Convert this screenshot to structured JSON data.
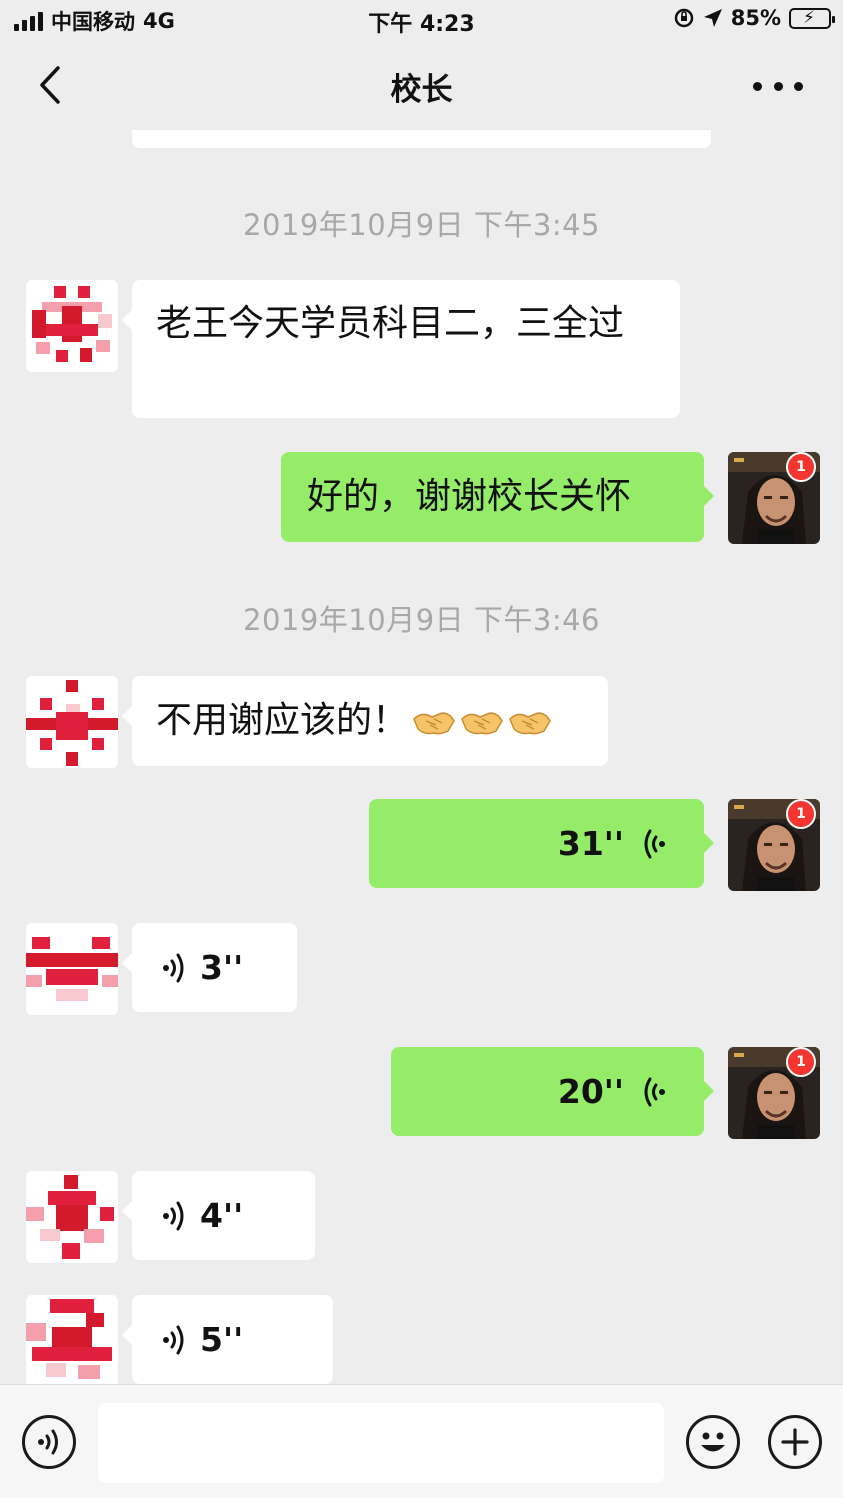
{
  "status_bar": {
    "carrier": "中国移动",
    "network": "4G",
    "time": "下午 4:23",
    "battery": "85%",
    "battery_level": 0.85
  },
  "nav": {
    "title": "校长",
    "back_icon": "chevron-left-icon",
    "more_icon": "more-dots-icon"
  },
  "messages": [
    {
      "type": "timestamp",
      "text": "2019年10月9日 下午3:45"
    },
    {
      "type": "text",
      "side": "in",
      "text": "老王今天学员科目二，三全过"
    },
    {
      "type": "text",
      "side": "out",
      "text": "好的，谢谢校长关怀",
      "badge": "1"
    },
    {
      "type": "timestamp",
      "text": "2019年10月9日 下午3:46"
    },
    {
      "type": "text",
      "side": "in",
      "text": "不用谢应该的！",
      "emoji": [
        "handshake-icon",
        "handshake-icon",
        "handshake-icon"
      ]
    },
    {
      "type": "voice",
      "side": "out",
      "duration": "31''",
      "badge": "1"
    },
    {
      "type": "voice",
      "side": "in",
      "duration": "3''"
    },
    {
      "type": "voice",
      "side": "out",
      "duration": "20''",
      "badge": "1"
    },
    {
      "type": "voice",
      "side": "in",
      "duration": "4''"
    },
    {
      "type": "voice",
      "side": "in",
      "duration": "5''"
    }
  ],
  "input_bar": {
    "voice_icon": "voice-toggle-icon",
    "text_value": "",
    "emoji_icon": "smiley-icon",
    "plus_icon": "plus-icon"
  },
  "colors": {
    "background": "#ededed",
    "outgoing_bubble": "#95ec69",
    "incoming_bubble": "#ffffff",
    "timestamp_text": "#a8a8a8",
    "badge": "#f43530"
  }
}
